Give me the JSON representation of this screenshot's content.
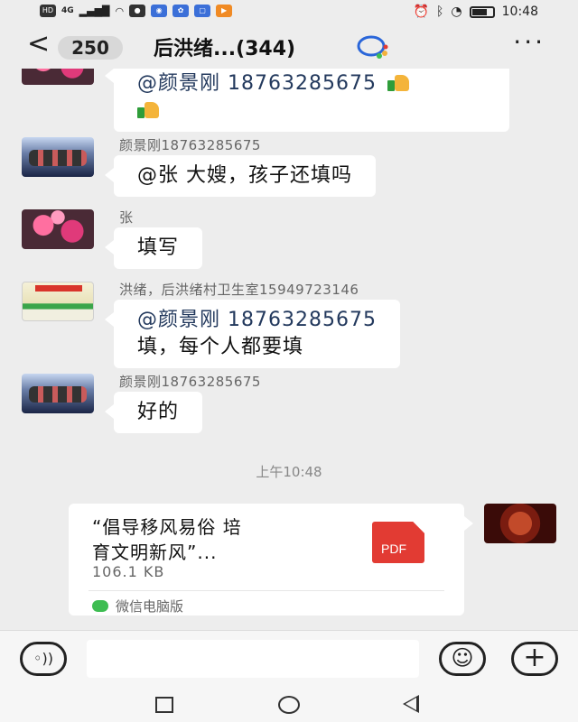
{
  "status_bar": {
    "indicators": [
      "HD",
      "4G"
    ],
    "time": "10:48",
    "icons": [
      "signal-icon",
      "wifi-icon",
      "qq-icon",
      "browser-icon",
      "baidu-icon",
      "app-icon",
      "video-app-icon",
      "alarm-icon",
      "bluetooth-icon",
      "speed-icon",
      "battery-icon"
    ]
  },
  "header": {
    "back_icon": "back-chevron-icon",
    "unread_count": "250",
    "title": "后洪绪...(344)",
    "more_icon": "more-dots-icon"
  },
  "messages": [
    {
      "sender": "",
      "avatar": "flower-avatar",
      "mention": "@颜景刚 18763285675",
      "text": "",
      "emojis": 2
    },
    {
      "sender": "颜景刚18763285675",
      "avatar": "band-avatar",
      "mention": "",
      "text": "@张  大嫂，孩子还填吗"
    },
    {
      "sender": "张",
      "avatar": "flower-avatar",
      "mention": "",
      "text": "填写"
    },
    {
      "sender": "洪绪，后洪绪村卫生室15949723146",
      "avatar": "poster-avatar",
      "mention": "@颜景刚 18763285675",
      "text": "填，每个人都要填"
    },
    {
      "sender": "颜景刚18763285675",
      "avatar": "band-avatar",
      "mention": "",
      "text": "好的"
    }
  ],
  "timestamp": "上午10:48",
  "file_message": {
    "name_line1": "“倡导移风易俗 培",
    "name_line2": "育文明新风”...",
    "size": "106.1 KB",
    "file_type_label": "PDF",
    "source": "微信电脑版"
  },
  "input_bar": {
    "voice_icon": "voice-icon",
    "placeholder": "",
    "emoji_icon": "emoji-icon",
    "plus_icon": "plus-icon"
  },
  "colors": {
    "background": "#ededed",
    "bubble": "#ffffff",
    "mention": "#23395d",
    "pdf_red": "#e23b33",
    "wechat_green": "#3ebd52"
  }
}
